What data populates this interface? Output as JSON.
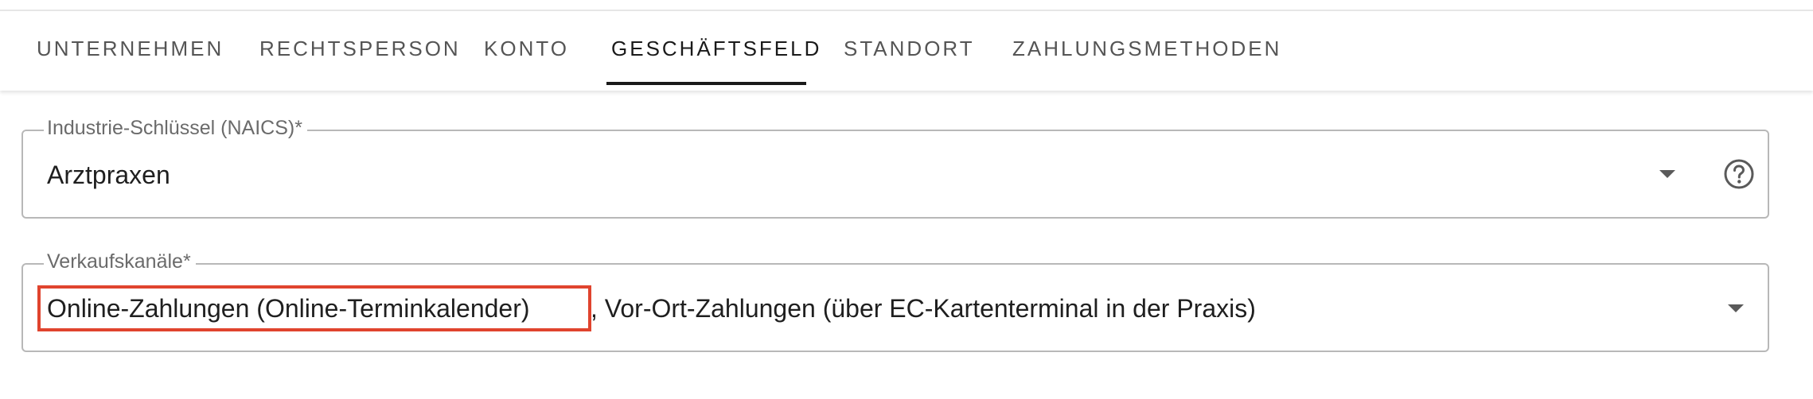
{
  "tabs": [
    {
      "label": "UNTERNEHMEN",
      "active": false
    },
    {
      "label": "RECHTSPERSON",
      "active": false
    },
    {
      "label": "KONTO",
      "active": false
    },
    {
      "label": "GESCHÄFTSFELD",
      "active": true
    },
    {
      "label": "STANDORT",
      "active": false
    },
    {
      "label": "ZAHLUNGSMETHODEN",
      "active": false
    }
  ],
  "industry_field": {
    "label": "Industrie-Schlüssel (NAICS)*",
    "value": "Arztpraxen",
    "icons": [
      "chevron-down-icon",
      "help-icon"
    ]
  },
  "sales_channels_field": {
    "label": "Verkaufskanäle*",
    "selected": [
      "Online-Zahlungen (Online-Terminkalender)",
      ", Vor-Ort-Zahlungen (über EC-Kartenterminal in der Praxis)"
    ],
    "highlight_color": "#e0442e",
    "icons": [
      "chevron-down-icon"
    ]
  },
  "colors": {
    "text": "#1f1f1f",
    "tab_inactive": "#555555",
    "tab_active": "#1a1a1a",
    "border": "#b8b8b8",
    "label": "#6b6b6b",
    "highlight": "#e0442e"
  }
}
